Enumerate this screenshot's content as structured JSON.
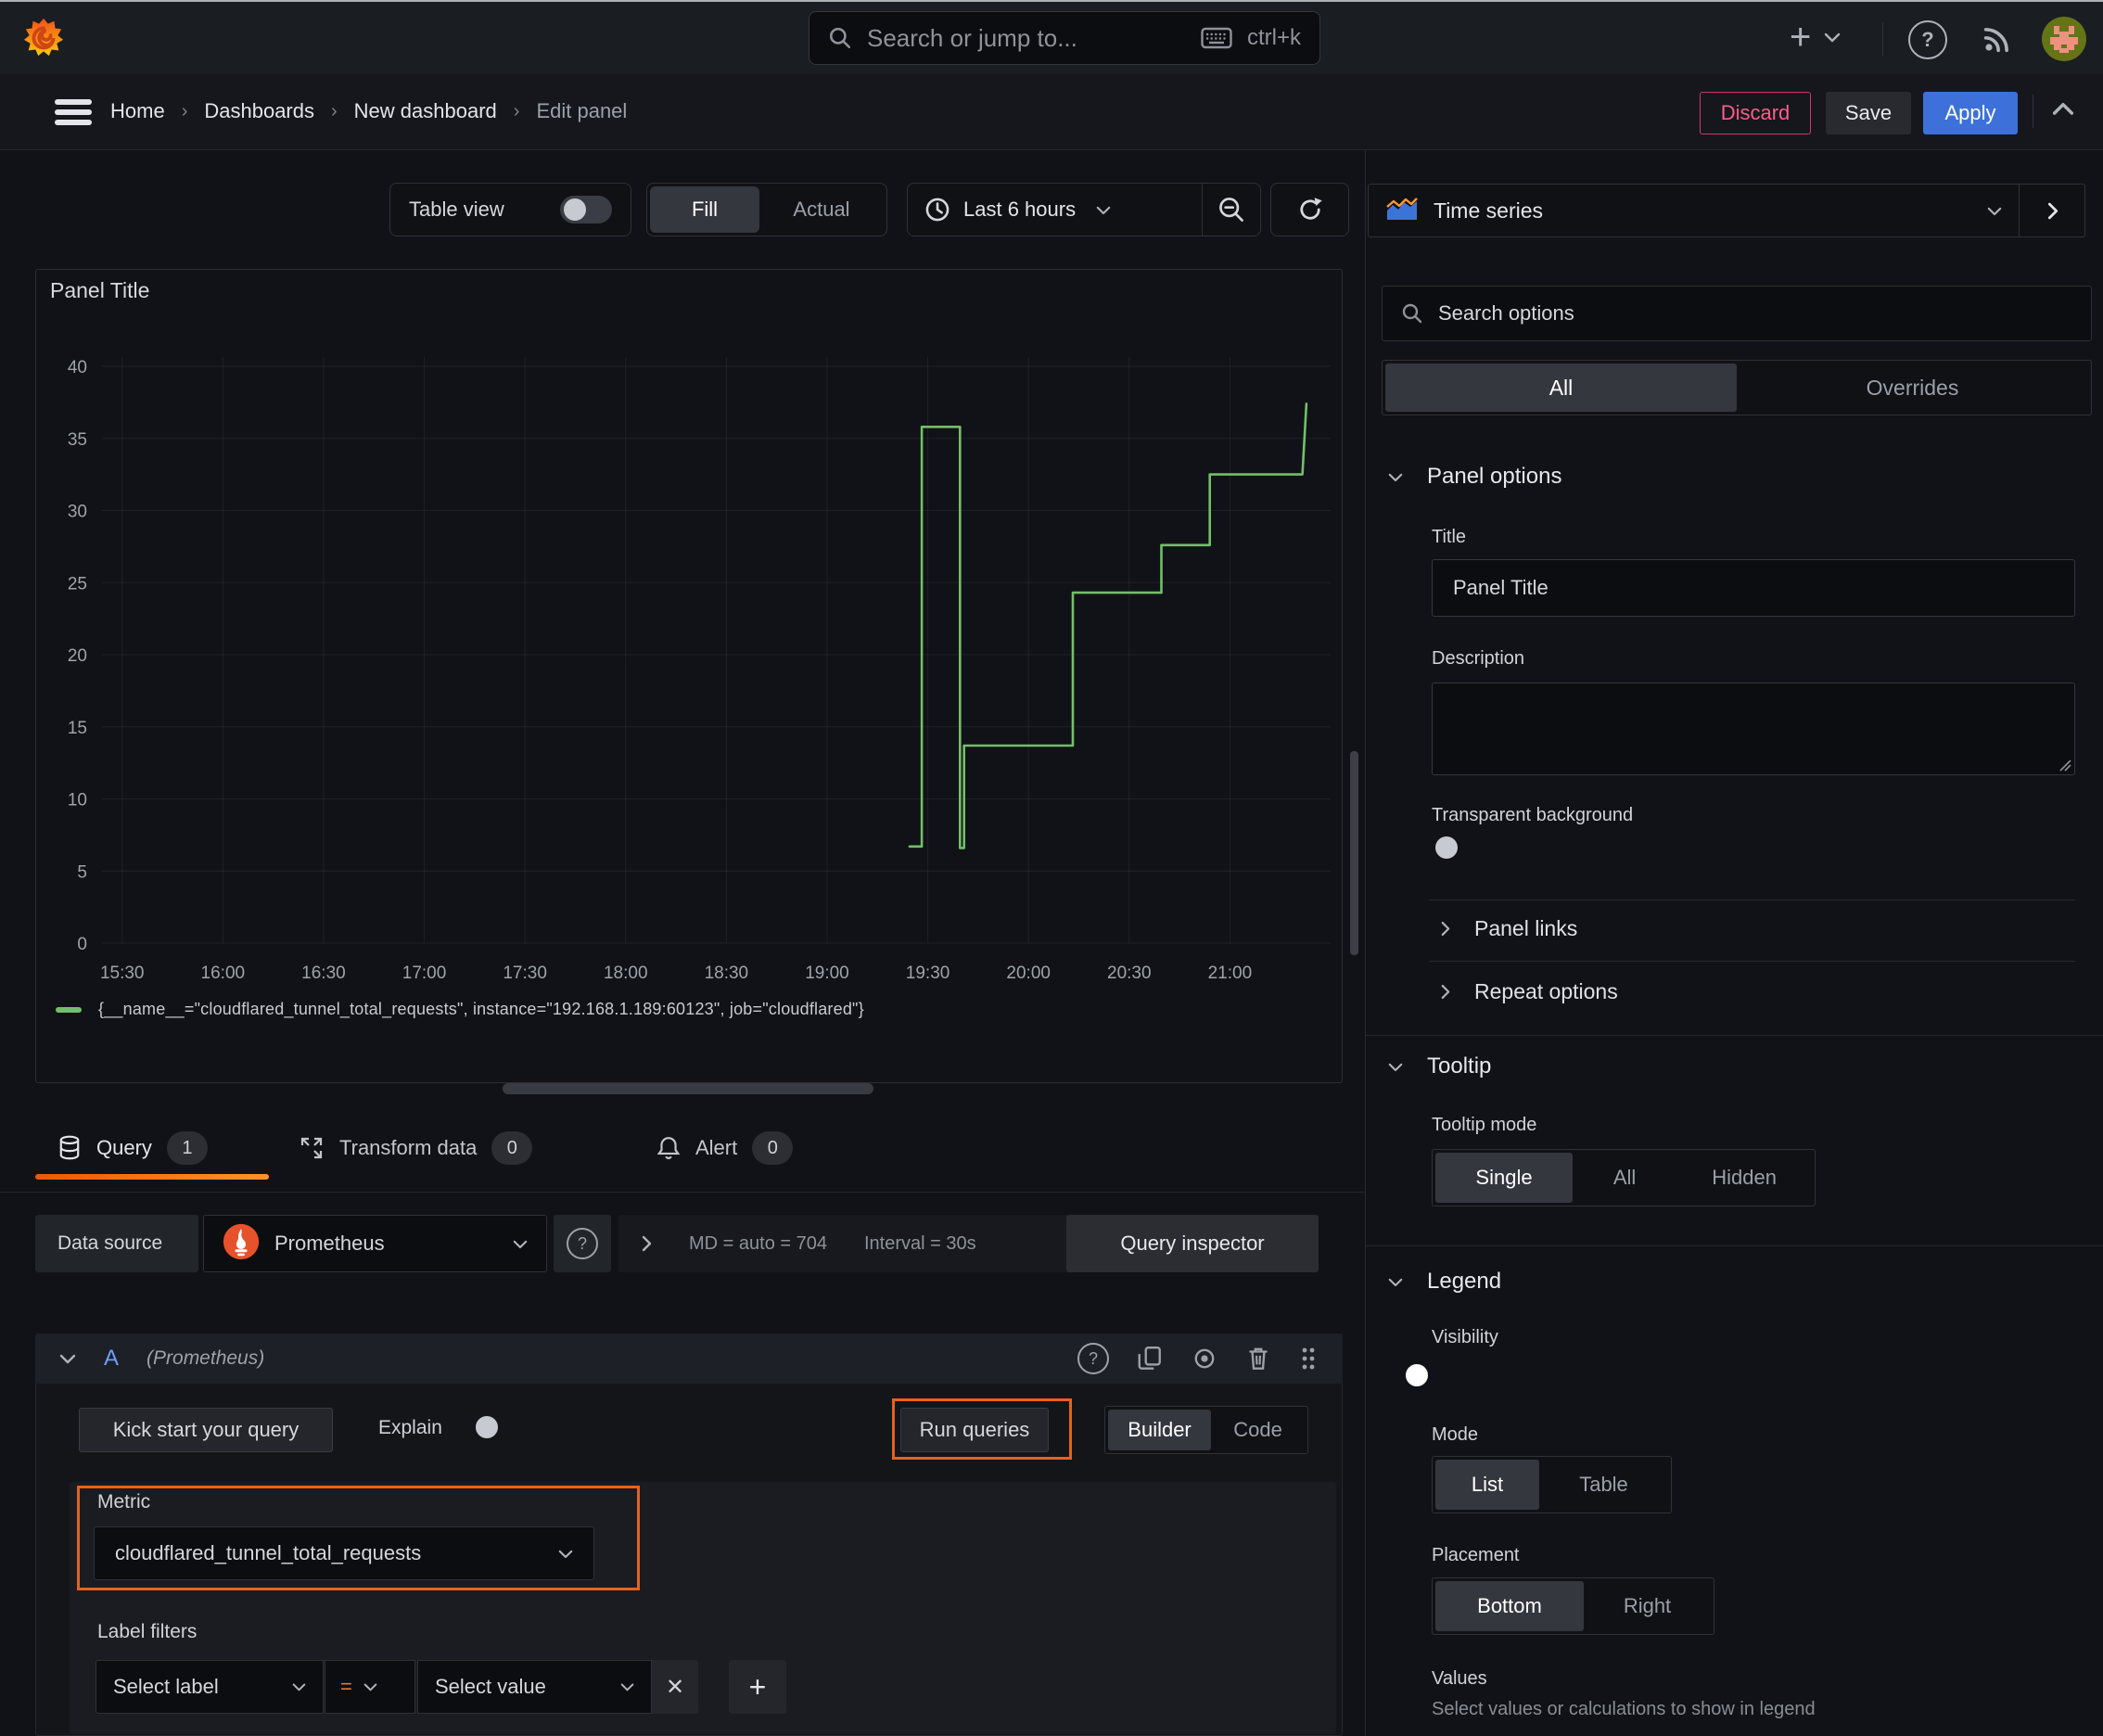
{
  "topbar": {
    "search_placeholder": "Search or jump to...",
    "search_shortcut": "ctrl+k"
  },
  "breadcrumb": {
    "items": [
      "Home",
      "Dashboards",
      "New dashboard",
      "Edit panel"
    ]
  },
  "header_actions": {
    "discard": "Discard",
    "save": "Save",
    "apply": "Apply"
  },
  "panel_toolbar": {
    "table_view_label": "Table view",
    "fill": "Fill",
    "actual": "Actual",
    "time_range": "Last 6 hours"
  },
  "chart_data": {
    "type": "line",
    "title": "Panel Title",
    "step": true,
    "grid": true,
    "legend_position": "bottom",
    "x_range_hours": [
      15.4,
      21.5
    ],
    "y_range": [
      0,
      40
    ],
    "y_ticks": [
      0,
      5,
      10,
      15,
      20,
      25,
      30,
      35,
      40
    ],
    "x_ticks": [
      {
        "label": "15:30",
        "t": 15.5
      },
      {
        "label": "16:00",
        "t": 16.0
      },
      {
        "label": "16:30",
        "t": 16.5
      },
      {
        "label": "17:00",
        "t": 17.0
      },
      {
        "label": "17:30",
        "t": 17.5
      },
      {
        "label": "18:00",
        "t": 18.0
      },
      {
        "label": "18:30",
        "t": 18.5
      },
      {
        "label": "19:00",
        "t": 19.0
      },
      {
        "label": "19:30",
        "t": 19.5
      },
      {
        "label": "20:00",
        "t": 20.0
      },
      {
        "label": "20:30",
        "t": 20.5
      },
      {
        "label": "21:00",
        "t": 21.0
      }
    ],
    "series": [
      {
        "name": "{__name__=\"cloudflared_tunnel_total_requests\", instance=\"192.168.1.189:60123\", job=\"cloudflared\"}",
        "color": "#73bf69",
        "points": [
          [
            19.41,
            6.7
          ],
          [
            19.47,
            6.7
          ],
          [
            19.47,
            35.8
          ],
          [
            19.66,
            35.8
          ],
          [
            19.66,
            6.6
          ],
          [
            19.68,
            6.6
          ],
          [
            19.68,
            13.7
          ],
          [
            20.22,
            13.7
          ],
          [
            20.22,
            24.3
          ],
          [
            20.66,
            24.3
          ],
          [
            20.66,
            27.6
          ],
          [
            20.9,
            27.6
          ],
          [
            20.9,
            32.5
          ],
          [
            21.36,
            32.5
          ],
          [
            21.38,
            37.4
          ]
        ]
      }
    ]
  },
  "query_section": {
    "tabs": [
      {
        "label": "Query",
        "badge": "1"
      },
      {
        "label": "Transform data",
        "badge": "0"
      },
      {
        "label": "Alert",
        "badge": "0"
      }
    ],
    "datasource": {
      "label": "Data source",
      "name": "Prometheus",
      "stat_md": "MD = auto = 704",
      "stat_interval": "Interval = 30s",
      "inspector": "Query inspector"
    },
    "row": {
      "ref": "A",
      "ds_hint": "(Prometheus)"
    },
    "toolbar": {
      "kickstart": "Kick start your query",
      "explain": "Explain",
      "run": "Run queries",
      "builder": "Builder",
      "code": "Code"
    },
    "builder": {
      "metric_label": "Metric",
      "metric_value": "cloudflared_tunnel_total_requests",
      "label_filters_label": "Label filters",
      "select_label": "Select label",
      "operator": "=",
      "select_value": "Select value",
      "remove": "✕",
      "add": "+"
    }
  },
  "sidebar": {
    "viz_name": "Time series",
    "search_placeholder": "Search options",
    "tabs": {
      "all": "All",
      "overrides": "Overrides"
    },
    "panel_options": {
      "header": "Panel options",
      "title_label": "Title",
      "title_value": "Panel Title",
      "description_label": "Description",
      "transparent_label": "Transparent background"
    },
    "collapsed": [
      {
        "label": "Panel links"
      },
      {
        "label": "Repeat options"
      }
    ],
    "tooltip": {
      "header": "Tooltip",
      "mode_label": "Tooltip mode",
      "options": [
        "Single",
        "All",
        "Hidden"
      ],
      "selected": "Single"
    },
    "legend": {
      "header": "Legend",
      "visibility_label": "Visibility",
      "mode_label": "Mode",
      "modes": [
        "List",
        "Table"
      ],
      "selected_mode": "List",
      "placement_label": "Placement",
      "placements": [
        "Bottom",
        "Right"
      ],
      "selected_placement": "Bottom",
      "values_label": "Values",
      "values_hint": "Select values or calculations to show in legend"
    }
  },
  "colors": {
    "accent_orange": "#e8621a",
    "brand_blue": "#3d71d9",
    "destructive_pink": "#d6336c",
    "series_green": "#73bf69"
  }
}
